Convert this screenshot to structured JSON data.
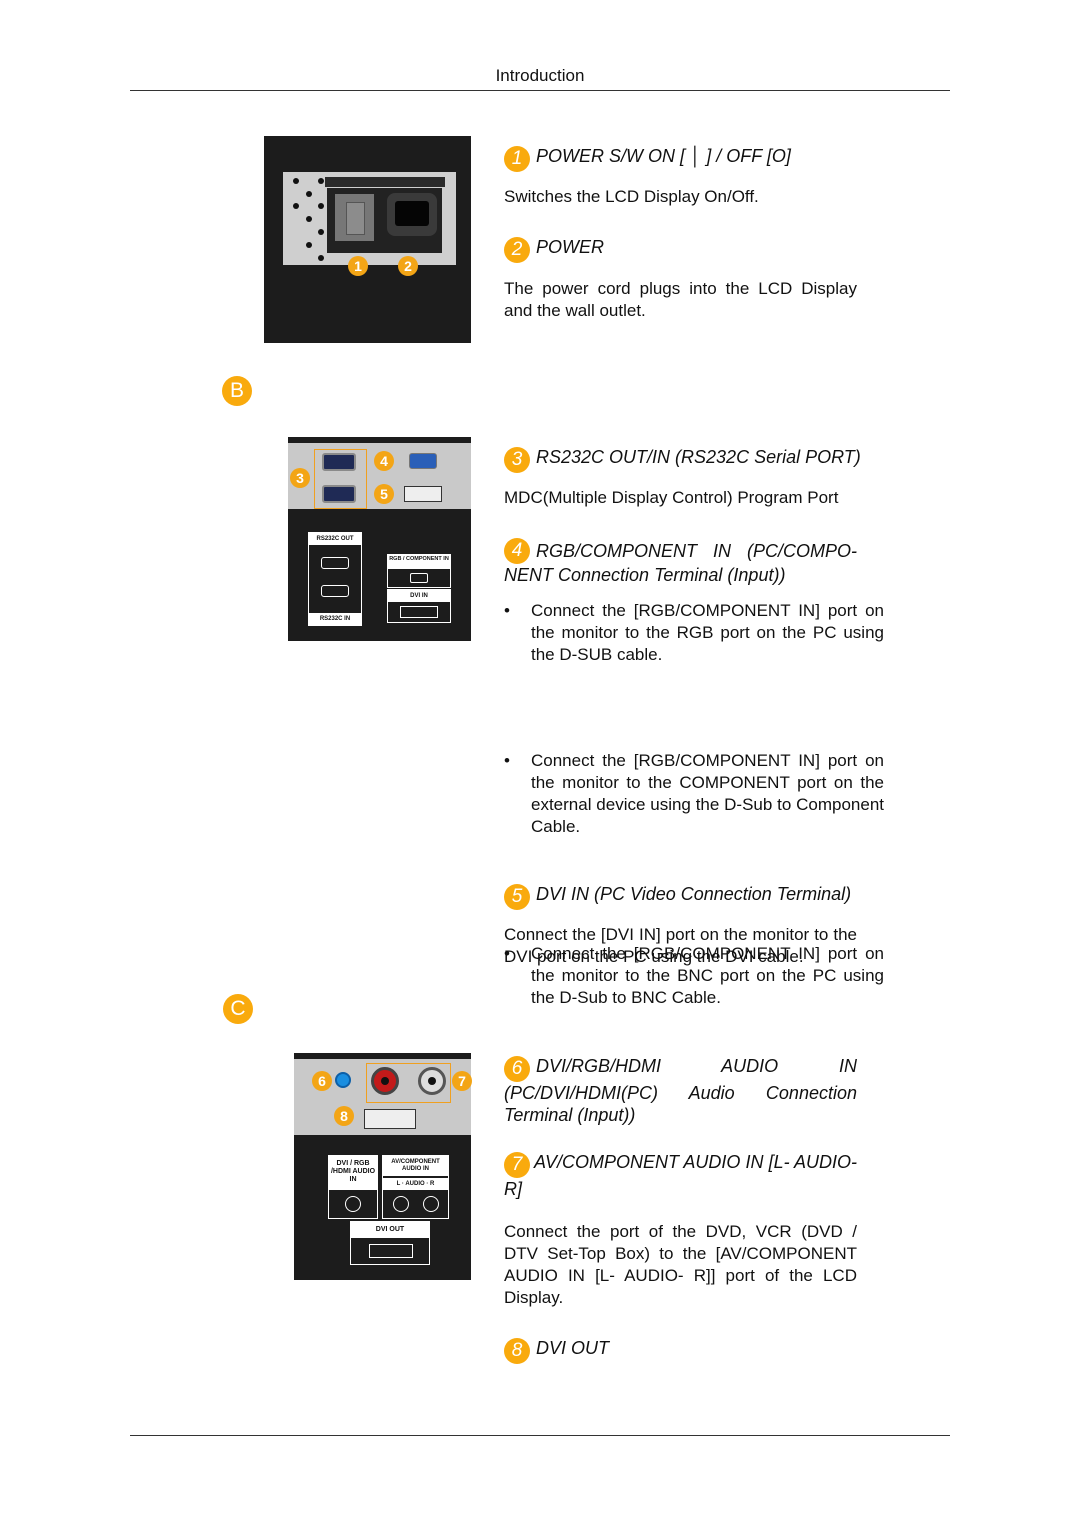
{
  "header": {
    "title": "Introduction"
  },
  "colors": {
    "badge": "#f9aa0d",
    "panel_bg": "#1c1c1c"
  },
  "sections": [
    {
      "badge": "B"
    },
    {
      "badge": "C"
    }
  ],
  "figures": {
    "power": {
      "callouts": [
        "1",
        "2"
      ]
    },
    "rear_b": {
      "callouts": [
        "3",
        "4",
        "5"
      ],
      "labels": {
        "rs232c_out": "RS232C OUT",
        "rs232c_in": "RS232C IN",
        "rgb_component_in": "RGB / COMPONENT IN",
        "dvi_in": "DVI IN"
      }
    },
    "rear_c": {
      "callouts": [
        "6",
        "7",
        "8"
      ],
      "labels": {
        "dvi_rgb_hdmi_audio_in": "DVI / RGB /HDMI AUDIO IN",
        "av_component_audio_in": "AV/COMPONENT AUDIO IN",
        "audio_lr": "L · AUDIO · R",
        "dvi_out": "DVI OUT"
      }
    }
  },
  "items": [
    {
      "num": "1",
      "title": "POWER S/W ON [ │ ] / OFF [O]",
      "body": "Switches the LCD Display On/Off."
    },
    {
      "num": "2",
      "title": "POWER",
      "body": "The power cord plugs into the LCD Display and the wall outlet."
    },
    {
      "num": "3",
      "title": "RS232C OUT/IN (RS232C Serial PORT)",
      "body": "MDC(Multiple Display Control) Program Port"
    },
    {
      "num": "4",
      "title": "RGB/COMPONENT IN (PC/COMPONENT Connection Terminal (Input))",
      "title_line1": "RGB/COMPONENT IN (PC/COMPO-",
      "title_line2": "NENT Connection Terminal (Input))",
      "bullets": [
        "Connect the [RGB/COMPONENT IN] port on the monitor to the RGB port on the PC using the D-SUB cable.",
        "Connect the [RGB/COMPONENT IN] port on the monitor to the COMPONENT port on the external device using the D-Sub to Component Cable.",
        "Connect the [RGB/COMPONENT IN] port on the monitor to the BNC port on the PC using the D-Sub to BNC Cable."
      ]
    },
    {
      "num": "5",
      "title": "DVI IN (PC Video Connection Terminal)",
      "body": "Connect the [DVI IN] port on the monitor to the DVI port on the PC using the DVI cable."
    },
    {
      "num": "6",
      "title": "DVI/RGB/HDMI AUDIO IN (PC/DVI/HDMI(PC) Audio Connection Terminal (Input))"
    },
    {
      "num": "7",
      "title": "AV/COMPONENT AUDIO IN [L- AUDIO-R]",
      "body": "Connect the port of the DVD, VCR (DVD / DTV Set-Top Box) to the [AV/COMPONENT AUDIO IN [L- AUDIO- R]] port of the LCD Display."
    },
    {
      "num": "8",
      "title": "DVI OUT"
    }
  ]
}
